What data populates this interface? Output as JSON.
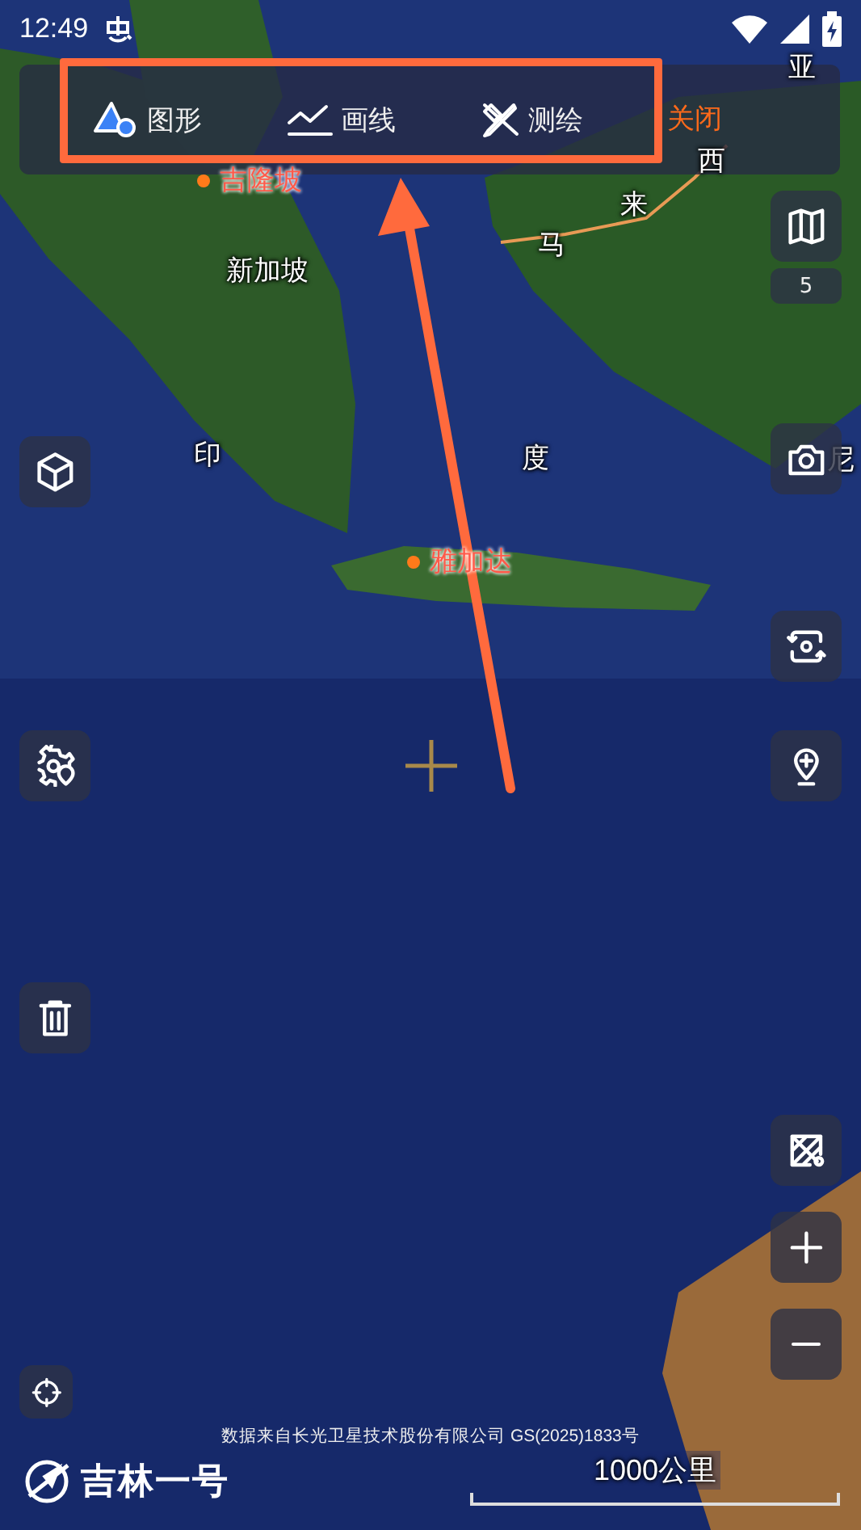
{
  "status_bar": {
    "time": "12:49"
  },
  "toolbar": {
    "tools": [
      {
        "kind": "shape",
        "label": "图形"
      },
      {
        "kind": "line",
        "label": "画线"
      },
      {
        "kind": "measure",
        "label": "测绘"
      }
    ],
    "close": "关闭"
  },
  "map_labels": [
    {
      "kind": "city",
      "text": "吉隆坡"
    },
    {
      "kind": "region",
      "text": "新加坡"
    },
    {
      "kind": "region",
      "text": "印"
    },
    {
      "kind": "region",
      "text": "度"
    },
    {
      "kind": "region",
      "text": "尼"
    },
    {
      "kind": "city",
      "text": "雅加达"
    },
    {
      "kind": "region",
      "text": "马"
    },
    {
      "kind": "region",
      "text": "来"
    },
    {
      "kind": "region",
      "text": "西"
    },
    {
      "kind": "region",
      "text": "亚"
    }
  ],
  "layers_count": "5",
  "attribution": "数据来自长光卫星技术股份有限公司 GS(2025)1833号",
  "logo": "吉林一号",
  "scale": "1000公里"
}
